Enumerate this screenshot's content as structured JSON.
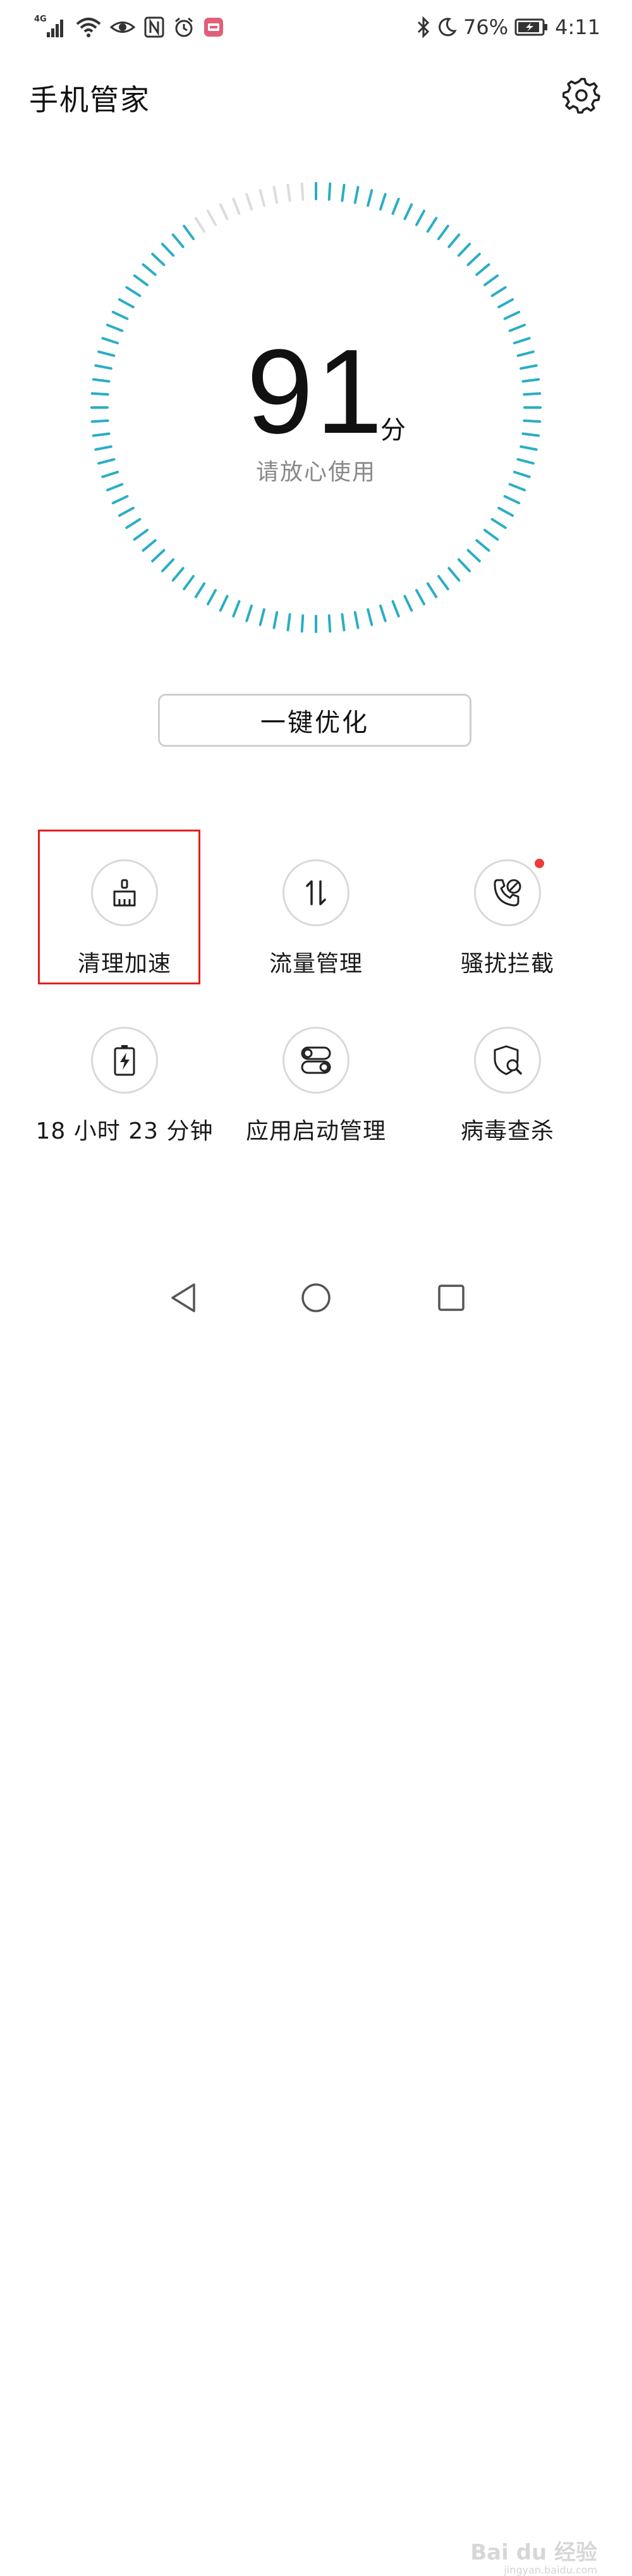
{
  "status_bar": {
    "network_tag": "4G",
    "battery_percent": "76%",
    "time": "4:11"
  },
  "header": {
    "title": "手机管家",
    "settings_icon": "gear-icon"
  },
  "score": {
    "value": "91",
    "unit": "分",
    "message": "请放心使用",
    "accent": "#2aaec4",
    "track": "#dcdcdc"
  },
  "optimize_button": {
    "label": "一键优化"
  },
  "tools": [
    {
      "label": "清理加速",
      "icon": "broom-icon"
    },
    {
      "label": "流量管理",
      "icon": "data-arrows-icon"
    },
    {
      "label": "骚扰拦截",
      "icon": "blocked-call-icon"
    },
    {
      "label": "18 小时 23 分钟",
      "icon": "battery-icon"
    },
    {
      "label": "应用启动管理",
      "icon": "app-launch-toggle-icon"
    },
    {
      "label": "病毒查杀",
      "icon": "shield-search-icon"
    }
  ],
  "watermark": {
    "text": "Bai du 经验",
    "sub": "jingyan.baidu.com"
  }
}
